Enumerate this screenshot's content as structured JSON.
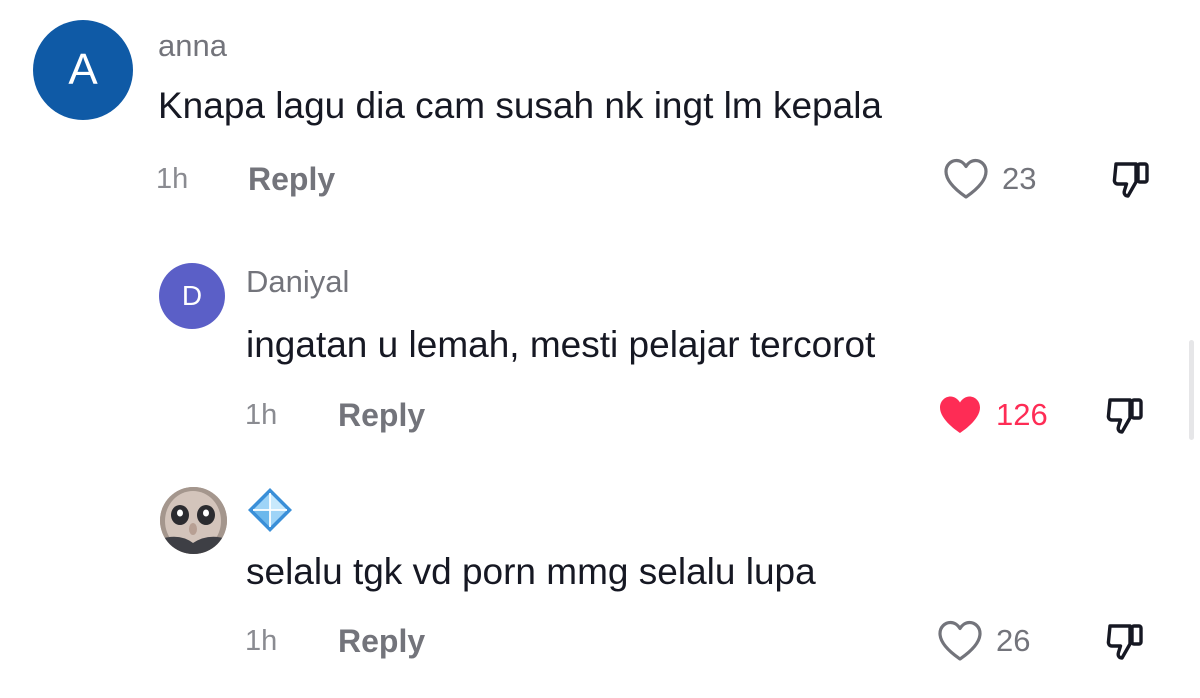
{
  "comments": [
    {
      "avatar_letter": "A",
      "avatar_color": "#0f5aa6",
      "username": "anna",
      "text": "Knapa lagu dia cam susah nk ingt lm kepala",
      "time": "1h",
      "reply_label": "Reply",
      "likes": "23",
      "liked": false
    },
    {
      "avatar_letter": "D",
      "avatar_color": "#5b5fc7",
      "username": "Daniyal",
      "text": "ingatan u lemah, mesti pelajar tercorot",
      "time": "1h",
      "reply_label": "Reply",
      "likes": "126",
      "liked": true
    },
    {
      "avatar_icon": "photo-avatar",
      "username_icon": "diamond-badge-icon",
      "text": "selalu tgk vd porn mmg selalu lupa",
      "time": "1h",
      "reply_label": "Reply",
      "likes": "26",
      "liked": false
    }
  ],
  "colors": {
    "liked_heart": "#fe2c55",
    "secondary_text": "#73747b"
  }
}
